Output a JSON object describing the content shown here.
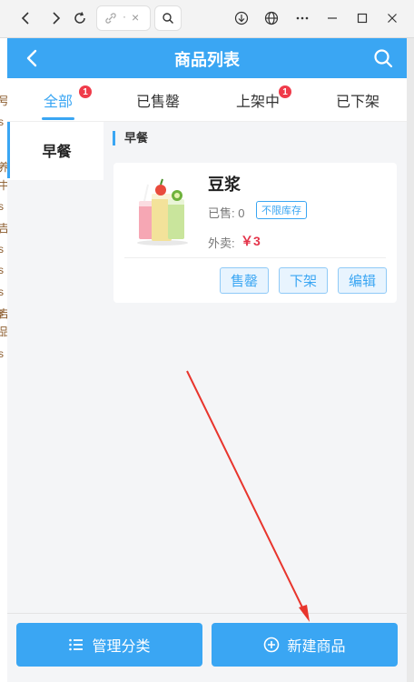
{
  "browser": {
    "address_dot": "·",
    "address_close": "×"
  },
  "background_sliver": [
    "号",
    "s",
    "养",
    "中",
    "s",
    "吉",
    "s",
    "s",
    "s",
    "s",
    "吉",
    "品",
    "s"
  ],
  "header": {
    "title": "商品列表"
  },
  "tabs": [
    {
      "label": "全部",
      "badge": "1"
    },
    {
      "label": "已售罄",
      "badge": ""
    },
    {
      "label": "上架中",
      "badge": "1"
    },
    {
      "label": "已下架",
      "badge": ""
    }
  ],
  "categories": [
    {
      "label": "早餐"
    }
  ],
  "section": {
    "title": "早餐"
  },
  "product": {
    "name": "豆浆",
    "sold_text": "已售: 0",
    "stock_badge": "不限库存",
    "price_label": "外卖:",
    "price": "￥3",
    "actions": [
      "售罄",
      "下架",
      "编辑"
    ]
  },
  "footer": {
    "manage_label": "管理分类",
    "new_label": "新建商品"
  },
  "colors": {
    "primary": "#3aa6f3",
    "badge": "#f03b4a",
    "price": "#e4344a",
    "annotation": "#e8352d"
  },
  "icons": {
    "back": "chevron-left-icon",
    "search": "search-icon",
    "manage": "list-icon",
    "new": "plus-circle-icon"
  }
}
